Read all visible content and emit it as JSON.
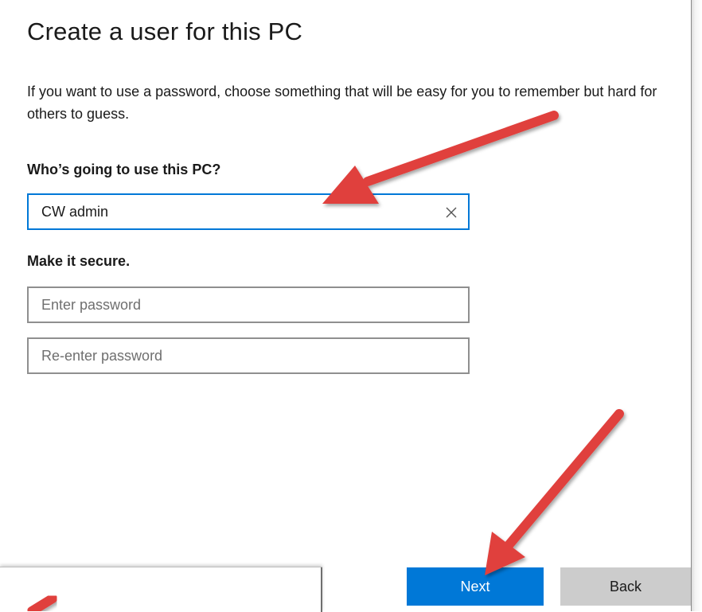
{
  "dialog": {
    "title": "Create a user for this PC",
    "description": "If you want to use a password, choose something that will be easy for you to remember but hard for others to guess.",
    "who_label": "Who’s going to use this PC?",
    "username": {
      "value": "CW admin",
      "placeholder": ""
    },
    "secure_label": "Make it secure.",
    "password": {
      "value": "",
      "placeholder": "Enter password"
    },
    "password_confirm": {
      "value": "",
      "placeholder": "Re-enter password"
    },
    "next_label": "Next",
    "back_label": "Back"
  },
  "icons": {
    "clear": "close-icon"
  },
  "colors": {
    "accent": "#0078d7",
    "annotation_arrow": "#e0413d",
    "secondary_button": "#cccccc",
    "field_border": "#8f8f8f"
  }
}
